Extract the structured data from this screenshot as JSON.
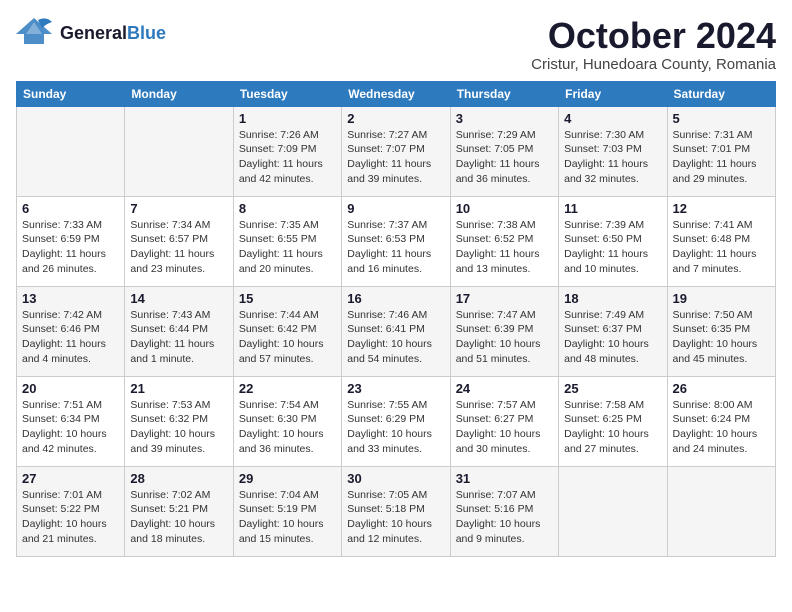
{
  "header": {
    "logo": {
      "general": "General",
      "blue": "Blue"
    },
    "title": "October 2024",
    "location": "Cristur, Hunedoara County, Romania"
  },
  "calendar": {
    "days_of_week": [
      "Sunday",
      "Monday",
      "Tuesday",
      "Wednesday",
      "Thursday",
      "Friday",
      "Saturday"
    ],
    "weeks": [
      [
        {
          "day": "",
          "info": ""
        },
        {
          "day": "",
          "info": ""
        },
        {
          "day": "1",
          "info": "Sunrise: 7:26 AM\nSunset: 7:09 PM\nDaylight: 11 hours and 42 minutes."
        },
        {
          "day": "2",
          "info": "Sunrise: 7:27 AM\nSunset: 7:07 PM\nDaylight: 11 hours and 39 minutes."
        },
        {
          "day": "3",
          "info": "Sunrise: 7:29 AM\nSunset: 7:05 PM\nDaylight: 11 hours and 36 minutes."
        },
        {
          "day": "4",
          "info": "Sunrise: 7:30 AM\nSunset: 7:03 PM\nDaylight: 11 hours and 32 minutes."
        },
        {
          "day": "5",
          "info": "Sunrise: 7:31 AM\nSunset: 7:01 PM\nDaylight: 11 hours and 29 minutes."
        }
      ],
      [
        {
          "day": "6",
          "info": "Sunrise: 7:33 AM\nSunset: 6:59 PM\nDaylight: 11 hours and 26 minutes."
        },
        {
          "day": "7",
          "info": "Sunrise: 7:34 AM\nSunset: 6:57 PM\nDaylight: 11 hours and 23 minutes."
        },
        {
          "day": "8",
          "info": "Sunrise: 7:35 AM\nSunset: 6:55 PM\nDaylight: 11 hours and 20 minutes."
        },
        {
          "day": "9",
          "info": "Sunrise: 7:37 AM\nSunset: 6:53 PM\nDaylight: 11 hours and 16 minutes."
        },
        {
          "day": "10",
          "info": "Sunrise: 7:38 AM\nSunset: 6:52 PM\nDaylight: 11 hours and 13 minutes."
        },
        {
          "day": "11",
          "info": "Sunrise: 7:39 AM\nSunset: 6:50 PM\nDaylight: 11 hours and 10 minutes."
        },
        {
          "day": "12",
          "info": "Sunrise: 7:41 AM\nSunset: 6:48 PM\nDaylight: 11 hours and 7 minutes."
        }
      ],
      [
        {
          "day": "13",
          "info": "Sunrise: 7:42 AM\nSunset: 6:46 PM\nDaylight: 11 hours and 4 minutes."
        },
        {
          "day": "14",
          "info": "Sunrise: 7:43 AM\nSunset: 6:44 PM\nDaylight: 11 hours and 1 minute."
        },
        {
          "day": "15",
          "info": "Sunrise: 7:44 AM\nSunset: 6:42 PM\nDaylight: 10 hours and 57 minutes."
        },
        {
          "day": "16",
          "info": "Sunrise: 7:46 AM\nSunset: 6:41 PM\nDaylight: 10 hours and 54 minutes."
        },
        {
          "day": "17",
          "info": "Sunrise: 7:47 AM\nSunset: 6:39 PM\nDaylight: 10 hours and 51 minutes."
        },
        {
          "day": "18",
          "info": "Sunrise: 7:49 AM\nSunset: 6:37 PM\nDaylight: 10 hours and 48 minutes."
        },
        {
          "day": "19",
          "info": "Sunrise: 7:50 AM\nSunset: 6:35 PM\nDaylight: 10 hours and 45 minutes."
        }
      ],
      [
        {
          "day": "20",
          "info": "Sunrise: 7:51 AM\nSunset: 6:34 PM\nDaylight: 10 hours and 42 minutes."
        },
        {
          "day": "21",
          "info": "Sunrise: 7:53 AM\nSunset: 6:32 PM\nDaylight: 10 hours and 39 minutes."
        },
        {
          "day": "22",
          "info": "Sunrise: 7:54 AM\nSunset: 6:30 PM\nDaylight: 10 hours and 36 minutes."
        },
        {
          "day": "23",
          "info": "Sunrise: 7:55 AM\nSunset: 6:29 PM\nDaylight: 10 hours and 33 minutes."
        },
        {
          "day": "24",
          "info": "Sunrise: 7:57 AM\nSunset: 6:27 PM\nDaylight: 10 hours and 30 minutes."
        },
        {
          "day": "25",
          "info": "Sunrise: 7:58 AM\nSunset: 6:25 PM\nDaylight: 10 hours and 27 minutes."
        },
        {
          "day": "26",
          "info": "Sunrise: 8:00 AM\nSunset: 6:24 PM\nDaylight: 10 hours and 24 minutes."
        }
      ],
      [
        {
          "day": "27",
          "info": "Sunrise: 7:01 AM\nSunset: 5:22 PM\nDaylight: 10 hours and 21 minutes."
        },
        {
          "day": "28",
          "info": "Sunrise: 7:02 AM\nSunset: 5:21 PM\nDaylight: 10 hours and 18 minutes."
        },
        {
          "day": "29",
          "info": "Sunrise: 7:04 AM\nSunset: 5:19 PM\nDaylight: 10 hours and 15 minutes."
        },
        {
          "day": "30",
          "info": "Sunrise: 7:05 AM\nSunset: 5:18 PM\nDaylight: 10 hours and 12 minutes."
        },
        {
          "day": "31",
          "info": "Sunrise: 7:07 AM\nSunset: 5:16 PM\nDaylight: 10 hours and 9 minutes."
        },
        {
          "day": "",
          "info": ""
        },
        {
          "day": "",
          "info": ""
        }
      ]
    ]
  }
}
